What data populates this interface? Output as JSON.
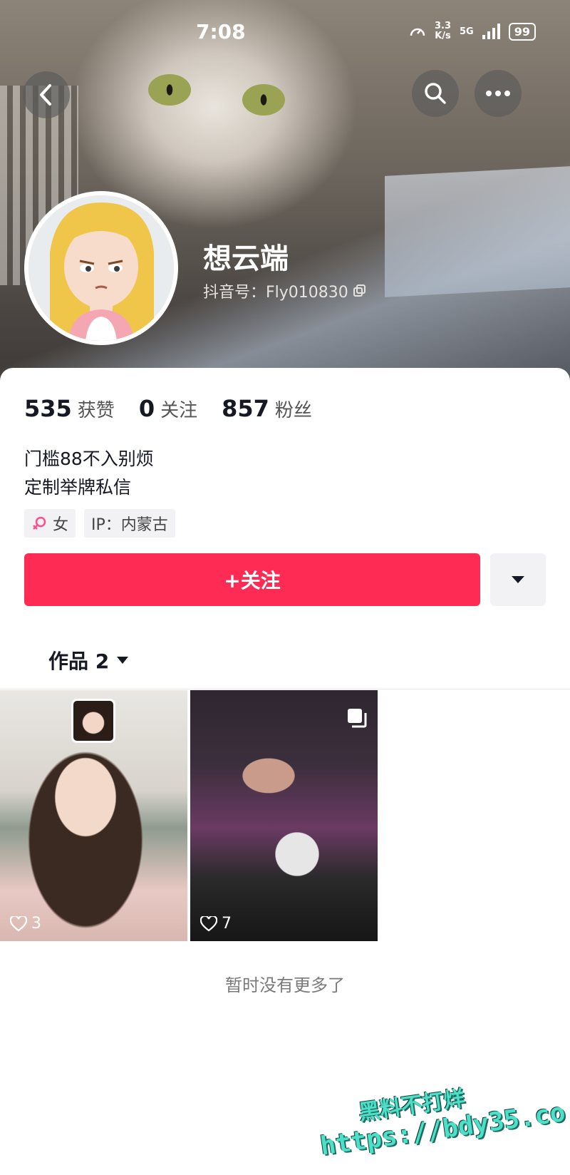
{
  "status_bar": {
    "time": "7:08",
    "speed_value": "3.3",
    "speed_unit": "K/s",
    "network": "5G",
    "battery": "99"
  },
  "header": {
    "back_icon": "chevron-left-icon",
    "search_icon": "search-icon",
    "more_icon": "more-horizontal-icon"
  },
  "profile": {
    "name": "想云端",
    "id_label": "抖音号：Fly010830",
    "copy_icon": "copy-icon"
  },
  "stats": [
    {
      "value": "535",
      "label": "获赞"
    },
    {
      "value": "0",
      "label": "关注"
    },
    {
      "value": "857",
      "label": "粉丝"
    }
  ],
  "bio": {
    "line1": "门槛88不入别烦",
    "line2": "定制举牌私信"
  },
  "tags": {
    "gender": "女",
    "gender_icon": "female-icon",
    "ip": "IP：内蒙古"
  },
  "actions": {
    "follow_label": "+关注",
    "dropdown_icon": "caret-down-icon"
  },
  "tabs": {
    "works_label": "作品 2"
  },
  "videos": [
    {
      "likes": "3"
    },
    {
      "likes": "7"
    }
  ],
  "footer": {
    "no_more": "暂时没有更多了"
  },
  "watermark": {
    "line1": "黑料不打烊",
    "line2": "https://bdy35.co"
  },
  "colors": {
    "accent": "#fe2c55",
    "female": "#ff4d8d"
  }
}
